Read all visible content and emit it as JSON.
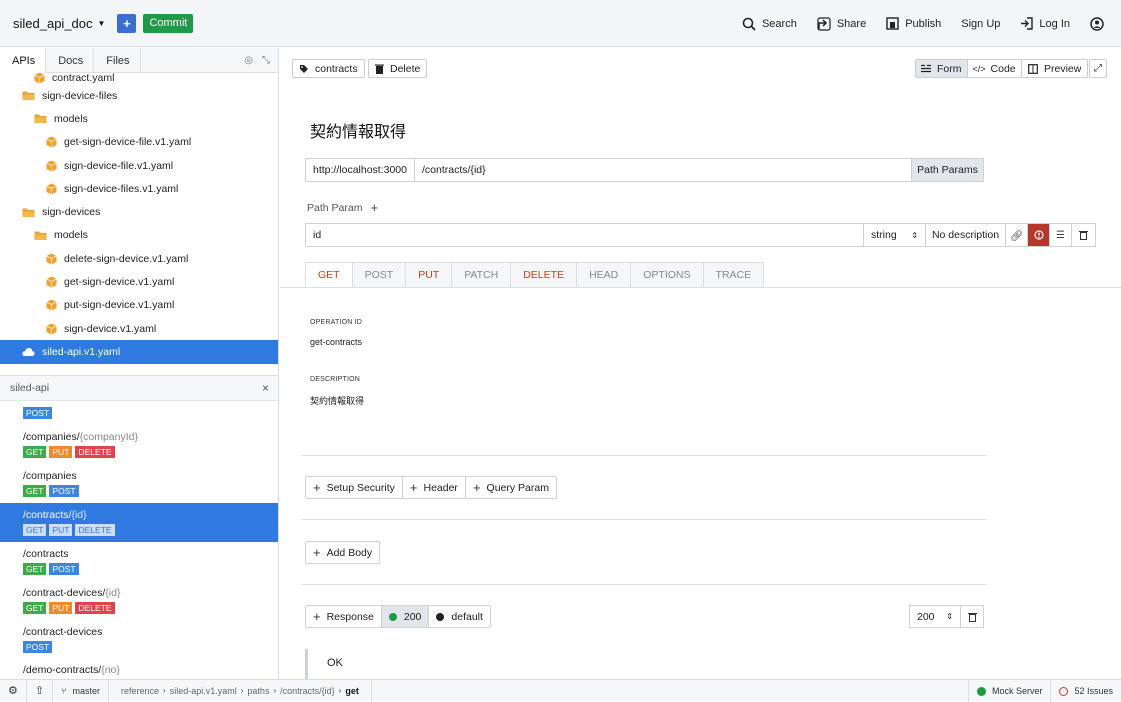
{
  "topbar": {
    "project": "siled_api_doc",
    "add_label": "+",
    "commit_label": "Commit",
    "search_label": "Search",
    "share_label": "Share",
    "publish_label": "Publish",
    "signup_label": "Sign Up",
    "login_label": "Log In"
  },
  "left": {
    "tabs": [
      "APIs",
      "Docs",
      "Files"
    ],
    "tree": [
      {
        "label": "contract.yaml",
        "type": "file",
        "indent": 2
      },
      {
        "label": "sign-device-files",
        "type": "folder",
        "indent": 1
      },
      {
        "label": "models",
        "type": "folder",
        "indent": 2
      },
      {
        "label": "get-sign-device-file.v1.yaml",
        "type": "file",
        "indent": 3
      },
      {
        "label": "sign-device-file.v1.yaml",
        "type": "file",
        "indent": 3
      },
      {
        "label": "sign-device-files.v1.yaml",
        "type": "file",
        "indent": 3
      },
      {
        "label": "sign-devices",
        "type": "folder",
        "indent": 1
      },
      {
        "label": "models",
        "type": "folder",
        "indent": 2
      },
      {
        "label": "delete-sign-device.v1.yaml",
        "type": "file",
        "indent": 3
      },
      {
        "label": "get-sign-device.v1.yaml",
        "type": "file",
        "indent": 3
      },
      {
        "label": "put-sign-device.v1.yaml",
        "type": "file",
        "indent": 3
      },
      {
        "label": "sign-device.v1.yaml",
        "type": "file",
        "indent": 3
      },
      {
        "label": "siled-api.v1.yaml",
        "type": "cloud",
        "indent": 1,
        "selected": true
      }
    ],
    "filter_label": "siled-api",
    "first_badge": "POST",
    "paths": [
      {
        "path": "/companies/",
        "param": "{companyId}",
        "methods": [
          "GET",
          "PUT",
          "DELETE"
        ]
      },
      {
        "path": "/companies",
        "param": "",
        "methods": [
          "GET",
          "POST"
        ]
      },
      {
        "path": "/contracts/",
        "param": "{id}",
        "methods": [
          "GET",
          "PUT",
          "DELETE"
        ],
        "selected": true
      },
      {
        "path": "/contracts",
        "param": "",
        "methods": [
          "GET",
          "POST"
        ]
      },
      {
        "path": "/contract-devices/",
        "param": "{id}",
        "methods": [
          "GET",
          "PUT",
          "DELETE"
        ]
      },
      {
        "path": "/contract-devices",
        "param": "",
        "methods": [
          "POST"
        ]
      },
      {
        "path": "/demo-contracts/",
        "param": "{no}",
        "methods": []
      }
    ]
  },
  "main": {
    "tag_label": "contracts",
    "delete_label": "Delete",
    "form_label": "Form",
    "code_label": "Code",
    "preview_label": "Preview",
    "title": "契約情報取得",
    "server": "http://localhost:3000",
    "path": "/contracts/{id}",
    "path_params_label": "Path Params",
    "path_param_title": "Path Param",
    "param_name": "id",
    "param_type": "string",
    "param_desc": "No description",
    "methods": [
      "GET",
      "POST",
      "PUT",
      "PATCH",
      "DELETE",
      "HEAD",
      "OPTIONS",
      "TRACE"
    ],
    "active_method": "GET",
    "operation_id_label": "OPERATION ID",
    "operation_id": "get-contracts",
    "description_label": "DESCRIPTION",
    "description": "契約情報取得",
    "setup_security_label": "Setup Security",
    "header_label": "Header",
    "query_param_label": "Query Param",
    "add_body_label": "Add Body",
    "response_label": "Response",
    "resp_200_label": "200",
    "resp_default_label": "default",
    "status_value": "200",
    "ok_text": "OK"
  },
  "bottom": {
    "branch": "master",
    "breadcrumb": [
      "reference",
      "siled-api.v1.yaml",
      "paths",
      "/contracts/{id}",
      "get"
    ],
    "mock_label": "Mock Server",
    "issues_label": "52 Issues"
  },
  "colors": {
    "accent": "#2f7ae0",
    "get": "#3cab4a",
    "post": "#3c87dd",
    "put": "#f08a2c",
    "delete": "#e0454f",
    "commit": "#1f9a47"
  }
}
